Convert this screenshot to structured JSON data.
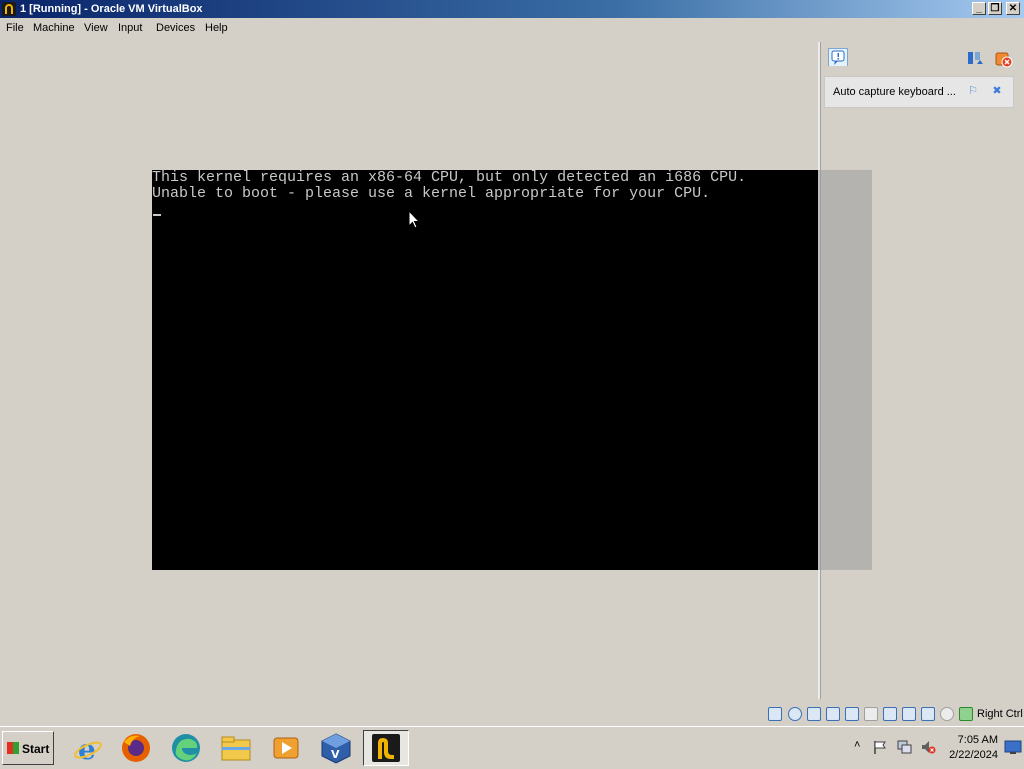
{
  "window": {
    "title": "1 [Running] - Oracle VM VirtualBox"
  },
  "menu": [
    "File",
    "Machine",
    "View",
    "Input",
    "Devices",
    "Help"
  ],
  "vm_screen": {
    "lines": [
      "This kernel requires an x86-64 CPU, but only detected an i686 CPU.",
      "Unable to boot - please use a kernel appropriate for your CPU."
    ]
  },
  "notification": {
    "text": "Auto capture keyboard ..."
  },
  "statusbar": {
    "host_key": "Right Ctrl"
  },
  "taskbar": {
    "start_label": "Start",
    "apps": [
      "internet-explorer",
      "firefox",
      "edge",
      "file-explorer",
      "media-player",
      "virtualbox-manager",
      "virtualbox-vm"
    ],
    "time": "7:05 AM",
    "date": "2/22/2024"
  },
  "colors": {
    "vm_bg": "#000000",
    "vm_text": "#c8c8c8",
    "chrome": "#d4d0c8",
    "titlebar": "#0a246a"
  }
}
